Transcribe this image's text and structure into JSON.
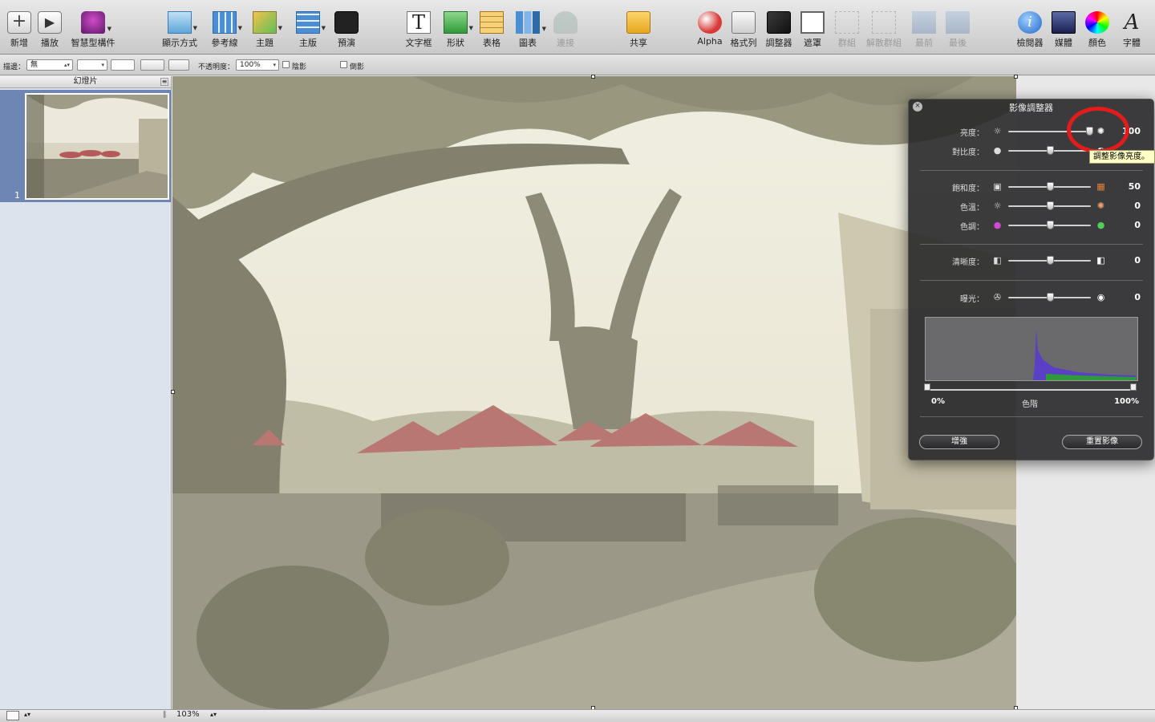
{
  "toolbar": {
    "items": [
      {
        "label": "新增",
        "icon": "plus-icon"
      },
      {
        "label": "播放",
        "icon": "play-icon"
      },
      {
        "label": "智慧型構件",
        "icon": "smart-build-icon"
      },
      {
        "label": "顯示方式",
        "icon": "view-icon"
      },
      {
        "label": "參考線",
        "icon": "guides-icon"
      },
      {
        "label": "主題",
        "icon": "themes-icon"
      },
      {
        "label": "主版",
        "icon": "masters-icon"
      },
      {
        "label": "預演",
        "icon": "rehearse-icon"
      },
      {
        "label": "文字框",
        "icon": "text-box-icon"
      },
      {
        "label": "形狀",
        "icon": "shapes-icon"
      },
      {
        "label": "表格",
        "icon": "table-icon"
      },
      {
        "label": "圖表",
        "icon": "chart-icon"
      },
      {
        "label": "連接",
        "icon": "connect-icon"
      },
      {
        "label": "共享",
        "icon": "share-icon"
      },
      {
        "label": "Alpha",
        "icon": "alpha-icon"
      },
      {
        "label": "格式列",
        "icon": "format-bar-icon"
      },
      {
        "label": "調整器",
        "icon": "adjust-icon"
      },
      {
        "label": "遮罩",
        "icon": "mask-icon"
      },
      {
        "label": "群組",
        "icon": "group-icon"
      },
      {
        "label": "解散群組",
        "icon": "ungroup-icon"
      },
      {
        "label": "最前",
        "icon": "front-icon"
      },
      {
        "label": "最後",
        "icon": "back-icon"
      },
      {
        "label": "檢閱器",
        "icon": "inspector-icon"
      },
      {
        "label": "媒體",
        "icon": "media-icon"
      },
      {
        "label": "顏色",
        "icon": "colors-icon"
      },
      {
        "label": "字體",
        "icon": "fonts-icon"
      }
    ]
  },
  "format_bar": {
    "stroke_label": "描邊：",
    "stroke_value": "無",
    "opacity_label": "不透明度：",
    "opacity_value": "100%",
    "shadow_label": "陰影",
    "reflection_label": "倒影"
  },
  "sidebar": {
    "title": "幻燈片",
    "slide_number": "1"
  },
  "bottom_bar": {
    "zoom": "103%"
  },
  "adjust_panel": {
    "title": "影像調整器",
    "rows": [
      {
        "label": "亮度：",
        "value": "100",
        "level": 0.98,
        "left_icon": "sun-small-icon",
        "right_icon": "sun-large-icon"
      },
      {
        "label": "對比度：",
        "value": "",
        "level": 0.5,
        "left_icon": "contrast-low-icon",
        "right_icon": "contrast-high-icon"
      },
      {
        "label": "飽和度：",
        "value": "50",
        "level": 0.5,
        "left_icon": "saturation-low-icon",
        "right_icon": "saturation-high-icon"
      },
      {
        "label": "色溫：",
        "value": "0",
        "level": 0.5,
        "left_icon": "cool-icon",
        "right_icon": "warm-icon"
      },
      {
        "label": "色調：",
        "value": "0",
        "level": 0.5,
        "left_icon": "tint-magenta-icon",
        "right_icon": "tint-green-icon"
      },
      {
        "label": "清晰度：",
        "value": "0",
        "level": 0.5,
        "left_icon": "sharpness-low-icon",
        "right_icon": "sharpness-high-icon"
      },
      {
        "label": "曝光：",
        "value": "0",
        "level": 0.5,
        "left_icon": "exposure-low-icon",
        "right_icon": "exposure-high-icon"
      }
    ],
    "levels_min": "0%",
    "levels_label": "色階",
    "levels_max": "100%",
    "enhance_label": "增強",
    "reset_label": "重置影像",
    "tooltip": "調整影像亮度。"
  }
}
